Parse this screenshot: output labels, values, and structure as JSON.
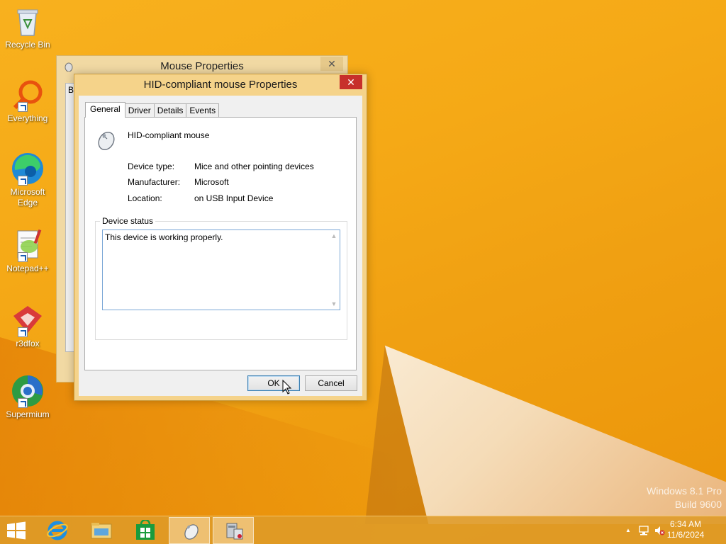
{
  "desktop": {
    "icons": [
      {
        "label": "Recycle Bin"
      },
      {
        "label": "Everything"
      },
      {
        "label": "Microsoft Edge"
      },
      {
        "label": "Notepad++"
      },
      {
        "label": "r3dfox"
      },
      {
        "label": "Supermium"
      }
    ],
    "watermark": {
      "line1": "Windows 8.1 Pro",
      "line2": "Build 9600"
    }
  },
  "back_window": {
    "title": "Mouse Properties",
    "close_glyph": "✕",
    "tab_peek": "B"
  },
  "dialog": {
    "title": "HID-compliant mouse Properties",
    "close_glyph": "✕",
    "tabs": [
      {
        "label": "General",
        "active": true
      },
      {
        "label": "Driver",
        "active": false
      },
      {
        "label": "Details",
        "active": false
      },
      {
        "label": "Events",
        "active": false
      }
    ],
    "device_name": "HID-compliant mouse",
    "properties": [
      {
        "key": "Device type:",
        "value": "Mice and other pointing devices"
      },
      {
        "key": "Manufacturer:",
        "value": "Microsoft"
      },
      {
        "key": "Location:",
        "value": "on USB Input Device"
      }
    ],
    "status_group_label": "Device status",
    "status_text": "This device is working properly.",
    "ok_label": "OK",
    "cancel_label": "Cancel"
  },
  "taskbar": {
    "apps": [
      "internet-explorer",
      "file-explorer",
      "store",
      "mouse-properties",
      "device-manager"
    ],
    "clock_time": "6:34 AM",
    "clock_date": "11/6/2024",
    "tray_chevron": "▲"
  },
  "colors": {
    "wallpaper": "#f5a916",
    "dialog_frame": "#f5d38a",
    "close_red": "#c7302b",
    "taskbar": "#de9b28"
  }
}
